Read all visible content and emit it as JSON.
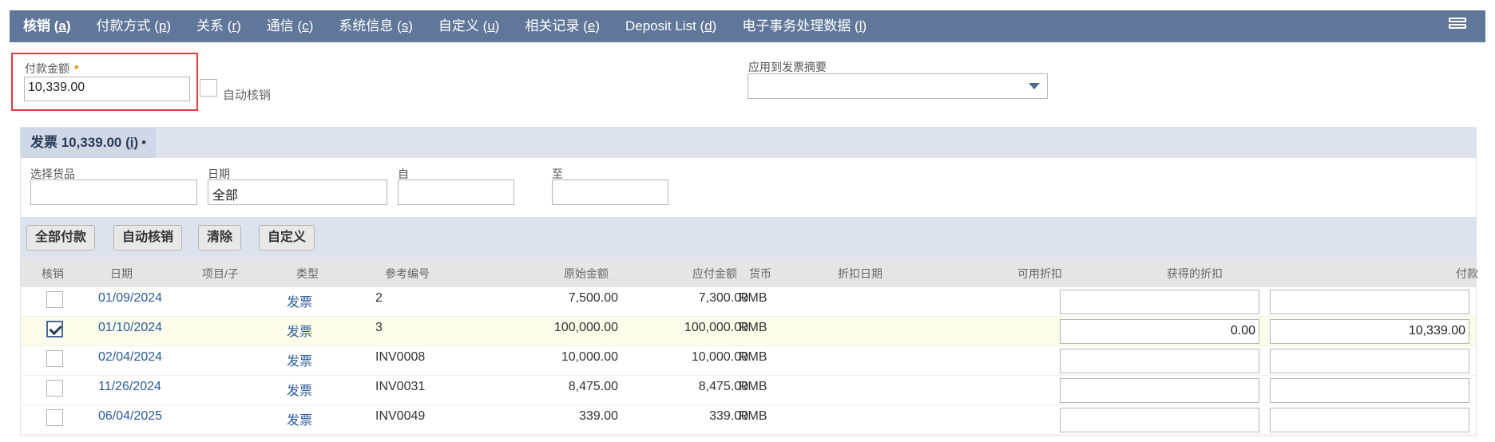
{
  "tabs": [
    {
      "label": "核销 (",
      "hk": "a",
      "end": ")"
    },
    {
      "label": "付款方式 (",
      "hk": "p",
      "end": ")"
    },
    {
      "label": "关系 (",
      "hk": "r",
      "end": ")"
    },
    {
      "label": "通信 (",
      "hk": "c",
      "end": ")"
    },
    {
      "label": "系统信息 (",
      "hk": "s",
      "end": ")"
    },
    {
      "label": "自定义 (",
      "hk": "u",
      "end": ")"
    },
    {
      "label": "相关记录 (",
      "hk": "e",
      "end": ")"
    },
    {
      "label": "Deposit List (",
      "hk": "d",
      "end": ")"
    },
    {
      "label": "电子事务处理数据 (",
      "hk": "l",
      "end": ")"
    }
  ],
  "payment": {
    "label": "付款金额",
    "required_mark": "*",
    "value": "10,339.00",
    "auto_apply_label": "自动核销"
  },
  "apply_to_summary": {
    "label": "应用到发票摘要",
    "value": ""
  },
  "sublist": {
    "tab_label": "发票 10,339.00 (",
    "tab_hk": "i",
    "tab_end": ")",
    "tab_dot": "•",
    "filters": {
      "item_label": "选择货品",
      "item_value": "",
      "date_label": "日期",
      "date_value": "全部",
      "from_label": "自",
      "from_value": "",
      "to_label": "至",
      "to_value": ""
    },
    "buttons": {
      "pay_all": "全部付款",
      "auto_apply": "自动核销",
      "clear": "清除",
      "customize": "自定义"
    },
    "columns": {
      "apply": "核销",
      "date": "日期",
      "item": "项目/子",
      "type": "类型",
      "ref": "参考编号",
      "orig": "原始金额",
      "due": "应付金额",
      "currency": "货币",
      "disc_date": "折扣日期",
      "disc_avail": "可用折扣",
      "disc_taken": "获得的折扣",
      "payment": "付款"
    },
    "rows": [
      {
        "checked": false,
        "date": "01/09/2024",
        "type": "发票",
        "ref": "2",
        "orig": "7,500.00",
        "due": "7,300.00",
        "currency": "RMB",
        "disc_taken": "",
        "payment": ""
      },
      {
        "checked": true,
        "date": "01/10/2024",
        "type": "发票",
        "ref": "3",
        "orig": "100,000.00",
        "due": "100,000.00",
        "currency": "RMB",
        "disc_taken": "0.00",
        "payment": "10,339.00"
      },
      {
        "checked": false,
        "date": "02/04/2024",
        "type": "发票",
        "ref": "INV0008",
        "orig": "10,000.00",
        "due": "10,000.00",
        "currency": "RMB",
        "disc_taken": "",
        "payment": ""
      },
      {
        "checked": false,
        "date": "11/26/2024",
        "type": "发票",
        "ref": "INV0031",
        "orig": "8,475.00",
        "due": "8,475.00",
        "currency": "RMB",
        "disc_taken": "",
        "payment": ""
      },
      {
        "checked": false,
        "date": "06/04/2025",
        "type": "发票",
        "ref": "INV0049",
        "orig": "339.00",
        "due": "339.00",
        "currency": "RMB",
        "disc_taken": "",
        "payment": ""
      }
    ]
  },
  "icons": {
    "menu": "list-view-icon",
    "dropdown": "caret-down-icon",
    "checkbox_checked": "checkmark-icon"
  }
}
